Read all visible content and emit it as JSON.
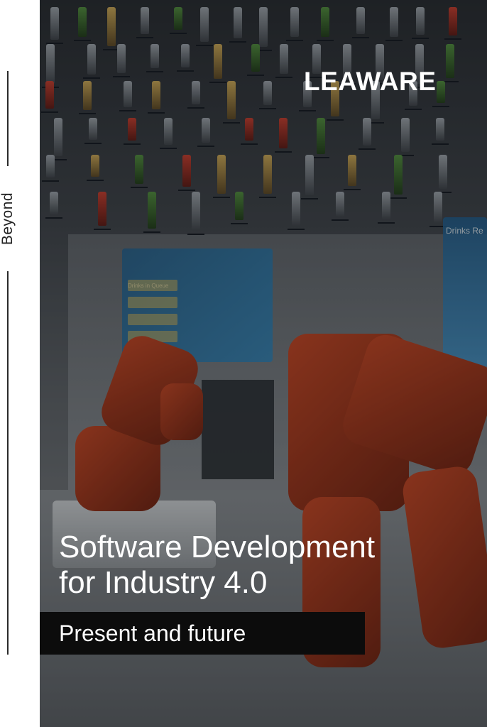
{
  "sidebar": {
    "vertical_label": "Beyond"
  },
  "brand": {
    "logo_text": "LEAWARE"
  },
  "cover": {
    "title_line1": "Software Development",
    "title_line2": "for Industry 4.0",
    "subtitle": "Present and future"
  },
  "photo": {
    "screen_left_header": "Drinks in Queue",
    "screen_right_header": "Drinks Re"
  },
  "colors": {
    "accent": "#c0421f",
    "overlay_bar": "#0c0c0c",
    "text": "#ffffff"
  }
}
